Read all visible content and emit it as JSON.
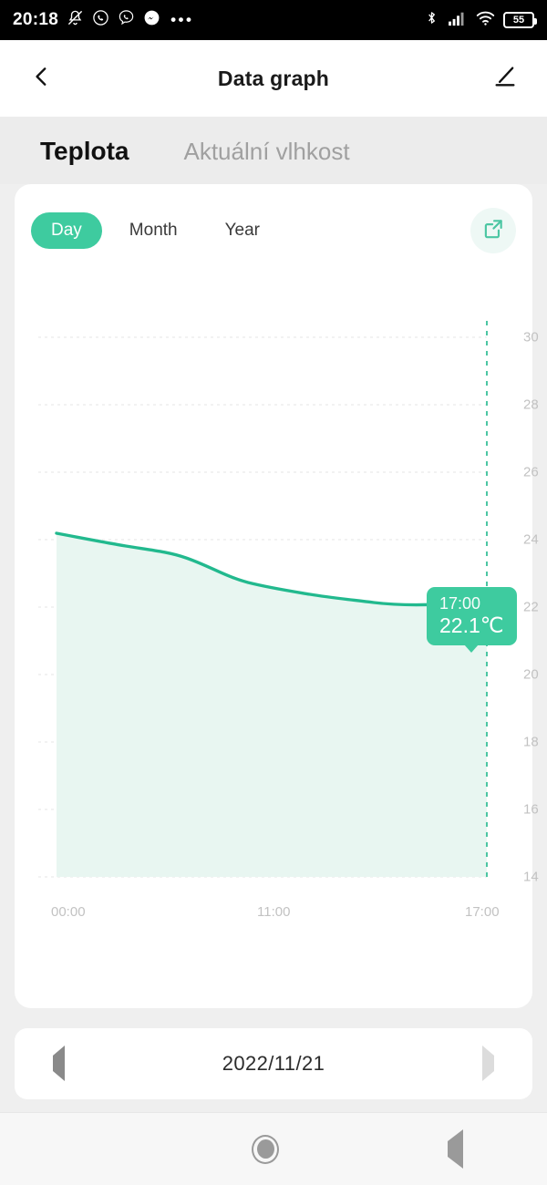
{
  "statusbar": {
    "time": "20:18",
    "icons": [
      "bell-muted-icon",
      "whatsapp-icon",
      "viber-icon",
      "messenger-icon"
    ],
    "overflow": "•••",
    "right_icons": [
      "bluetooth-icon",
      "cellular-signal-icon",
      "wifi-icon"
    ],
    "battery_level": "55"
  },
  "header": {
    "back_icon": "chevron-left-icon",
    "title": "Data graph",
    "edit_icon": "pencil-edit-icon"
  },
  "tabs": [
    {
      "label": "Teplota",
      "active": true
    },
    {
      "label": "Aktuální vlhkost",
      "active": false
    }
  ],
  "card": {
    "ranges": [
      {
        "label": "Day",
        "active": true
      },
      {
        "label": "Month",
        "active": false
      },
      {
        "label": "Year",
        "active": false
      }
    ],
    "share_icon": "share-external-link-icon",
    "tooltip": {
      "time": "17:00",
      "value": "22.1℃"
    }
  },
  "datebar": {
    "prev_icon": "triangle-left-icon",
    "date": "2022/11/21",
    "next_icon": "triangle-right-icon"
  },
  "navbar": {
    "recents_icon": "square-recents-icon",
    "home_icon": "circle-home-icon",
    "back_icon": "triangle-back-icon"
  },
  "colors": {
    "accent": "#3ecb9f",
    "area_fill": "#e8f6f1",
    "grid": "#eceaea",
    "axis_text": "#c2c2c2",
    "card_bg": "#ffffff",
    "page_bg": "#ececec"
  },
  "chart_data": {
    "type": "area",
    "title": "Teplota",
    "xlabel": "",
    "ylabel": "°C",
    "ylim": [
      14,
      30
    ],
    "yticks": [
      30,
      28,
      26,
      24,
      22,
      20,
      18,
      16,
      14
    ],
    "xticks": [
      "00:00",
      "11:00",
      "17:00"
    ],
    "grid": true,
    "legend": null,
    "series": [
      {
        "name": "Teplota",
        "unit": "℃",
        "x": [
          "00:00",
          "01:00",
          "02:00",
          "03:00",
          "04:00",
          "05:00",
          "06:00",
          "07:00",
          "08:00",
          "09:00",
          "10:00",
          "11:00",
          "12:00",
          "13:00",
          "14:00",
          "15:00",
          "16:00",
          "17:00"
        ],
        "values": [
          24.2,
          24.0,
          23.9,
          23.9,
          23.8,
          23.6,
          23.2,
          23.0,
          22.9,
          22.9,
          22.8,
          22.7,
          22.5,
          22.4,
          22.3,
          22.3,
          22.3,
          22.1
        ]
      }
    ],
    "highlight": {
      "x": "17:00",
      "y": 22.1,
      "label_time": "17:00",
      "label_value": "22.1℃"
    }
  }
}
